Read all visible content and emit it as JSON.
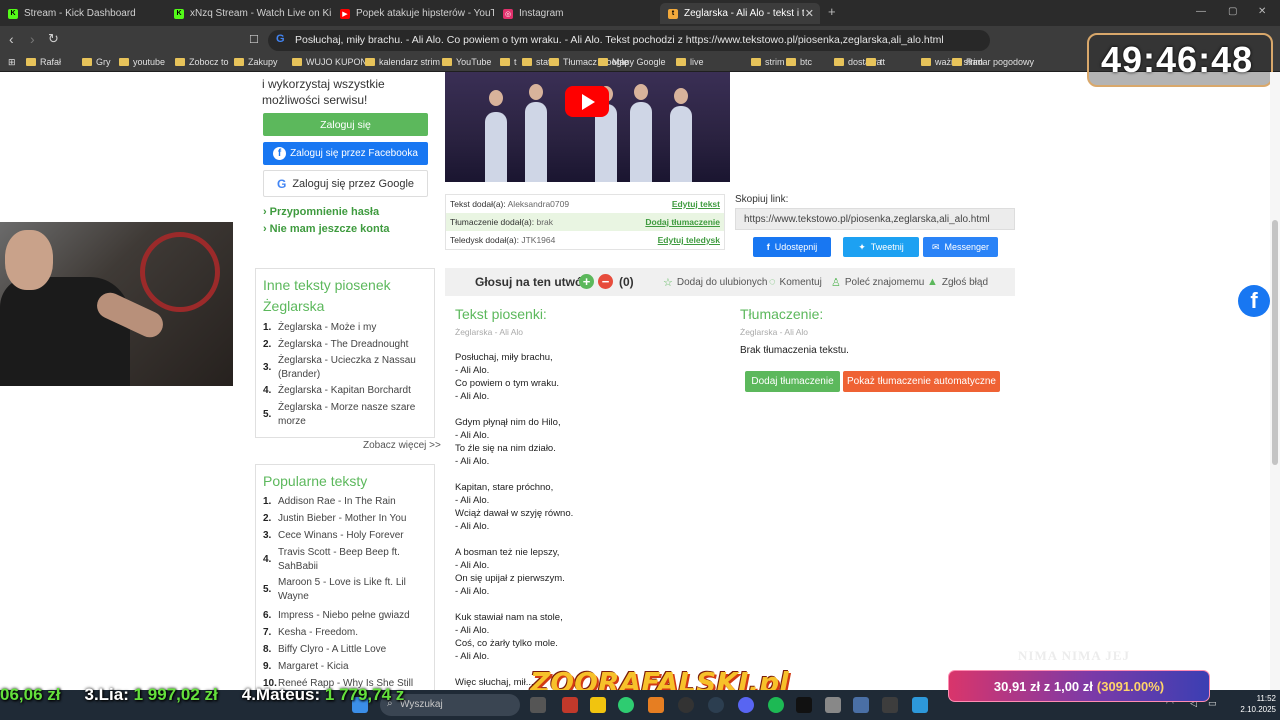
{
  "browser": {
    "tabs": [
      {
        "label": "Stream - Kick Dashboard",
        "fav_color": "#53fc18",
        "fav_text": "K"
      },
      {
        "label": "xNzq Stream - Watch Live on Kick",
        "fav_color": "#53fc18",
        "fav_text": "K"
      },
      {
        "label": "Popek atakuje hipsterów - YouTube",
        "fav_color": "#ff0000",
        "fav_text": "▶"
      },
      {
        "label": "Instagram",
        "fav_color": "#e1306c",
        "fav_text": "◎"
      },
      {
        "label": "Żeglarska - Ali Alo - tekst i tłum...",
        "fav_color": "#f2a93b",
        "fav_text": "t"
      }
    ],
    "new_tab": "+",
    "address": "Posłuchaj, miły brachu. - Ali Alo. Co powiem o tym wraku. - Ali Alo. Tekst pochodzi z https://www.tekstowo.pl/piosenka,zeglarska,ali_alo.html",
    "bookmarks": [
      "Rafał",
      "Gry",
      "youtube",
      "Zobocz to",
      "Zakupy",
      "WUJO KUPON",
      "kalendarz strim",
      "YouTube",
      "t",
      "stats",
      "Tłumacz Google",
      "Mapy Google",
      "live",
      "strim",
      "btc",
      "dostawa",
      "tt",
      "ważne strim",
      "Radar pogodowy"
    ]
  },
  "overlay": {
    "timer": "49:46:48",
    "ticker": [
      {
        "prefix": "",
        "amount": "06,06 zł"
      },
      {
        "prefix": "3.Lia: ",
        "amount": "1 997,02 zł"
      },
      {
        "prefix": "4.Mateus: ",
        "amount": "1 779,74 z"
      }
    ],
    "watermark": "NIMA NIMA JEJ",
    "brand": "ZOORAFALSKI.pl",
    "donation": {
      "main": "30,91 zł z 1,00 zł",
      "pct": "(3091.00%)"
    }
  },
  "sidebar": {
    "login_prompt": "i wykorzystaj wszystkie możliwości serwisu!",
    "login_button": "Zaloguj się",
    "facebook_button": "Zaloguj się przez Facebooka",
    "google_button": "Zaloguj się przez Google",
    "remind_link": "Przypomnienie hasła",
    "no_account_link": "Nie mam jeszcze konta",
    "other_songs": {
      "title": "Inne teksty piosenek Żeglarska",
      "items": [
        "Żeglarska - Może i my",
        "Żeglarska - The Dreadnought",
        "Żeglarska - Ucieczka z Nassau (Brander)",
        "Żeglarska - Kapitan Borchardt",
        "Żeglarska - Morze nasze szare morze"
      ],
      "more": "Zobacz więcej >>"
    },
    "popular": {
      "title": "Popularne teksty",
      "items": [
        "Addison Rae - In The Rain",
        "Justin Bieber - Mother In You",
        "Cece Winans - Holy Forever",
        "Travis Scott - Beep Beep ft. SahBabii",
        "Maroon 5 - Love is Like ft. Lil Wayne",
        "Impress - Niebo pełne gwiazd",
        "Kesha - Freedom.",
        "Biffy Clyro - A Little Love",
        "Margaret - Kicia",
        "Reneé Rapp - Why Is She Still"
      ]
    }
  },
  "info": {
    "rows": [
      {
        "label": "Tekst dodał(a): ",
        "value": "Aleksandra0709",
        "action": "Edytuj tekst"
      },
      {
        "label": "Tłumaczenie dodał(a): ",
        "value": "brak",
        "action": "Dodaj tłumaczenie"
      },
      {
        "label": "Teledysk dodał(a): ",
        "value": "JTK1964",
        "action": "Edytuj teledysk"
      }
    ]
  },
  "copy": {
    "label": "Skopiuj link:",
    "url": "https://www.tekstowo.pl/piosenka,zeglarska,ali_alo.html",
    "share_fb": "Udostępnij",
    "share_tw": "Tweetnij",
    "share_ms": "Messenger"
  },
  "vote": {
    "label": "Głosuj na ten utwór",
    "plus": "+",
    "minus": "−",
    "count": "(0)",
    "fav": "Dodaj do ulubionych",
    "comment": "Komentuj",
    "recommend": "Poleć znajomemu",
    "report": "Zgłoś błąd"
  },
  "lyrics": {
    "title": "Tekst piosenki:",
    "subtitle": "Żeglarska - Ali Alo",
    "lines": [
      "Posłuchaj, miły brachu,",
      "- Ali Alo.",
      "Co powiem o tym wraku.",
      "- Ali Alo.",
      "",
      "Gdym płynął nim do Hilo,",
      "- Ali Alo.",
      "To źle się na nim działo.",
      "- Ali Alo.",
      "",
      "Kapitan, stare próchno,",
      "- Ali Alo.",
      "Wciąż dawał w szyję równo.",
      "- Ali Alo.",
      "",
      "A bosman też nie lepszy,",
      "- Ali Alo.",
      "On się upijał z pierwszym.",
      "- Ali Alo.",
      "",
      "Kuk stawiał nam na stole,",
      "- Ali Alo.",
      "Coś, co żarły tylko mole.",
      "- Ali Alo.",
      "",
      "Więc słuchaj, mił..."
    ]
  },
  "translation": {
    "title": "Tłumaczenie:",
    "subtitle": "Żeglarska - Ali Alo",
    "empty": "Brak tłumaczenia tekstu.",
    "add_button": "Dodaj tłumaczenie",
    "auto_button": "Pokaż tłumaczenie automatyczne"
  },
  "taskbar": {
    "search_placeholder": "Wyszukaj",
    "time": "11:52",
    "date": "2.10.2025"
  }
}
